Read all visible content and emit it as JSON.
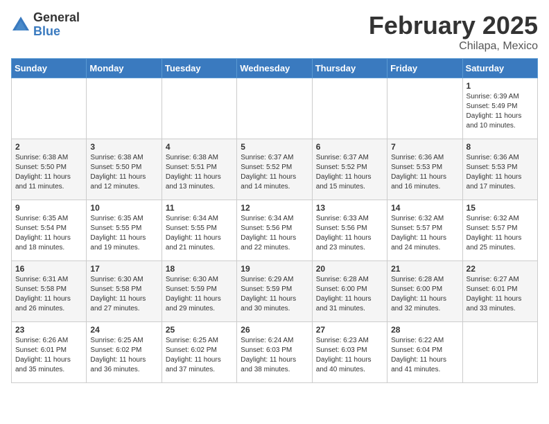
{
  "header": {
    "logo_general": "General",
    "logo_blue": "Blue",
    "title": "February 2025",
    "subtitle": "Chilapa, Mexico"
  },
  "days_of_week": [
    "Sunday",
    "Monday",
    "Tuesday",
    "Wednesday",
    "Thursday",
    "Friday",
    "Saturday"
  ],
  "weeks": [
    [
      {
        "day": "",
        "info": ""
      },
      {
        "day": "",
        "info": ""
      },
      {
        "day": "",
        "info": ""
      },
      {
        "day": "",
        "info": ""
      },
      {
        "day": "",
        "info": ""
      },
      {
        "day": "",
        "info": ""
      },
      {
        "day": "1",
        "info": "Sunrise: 6:39 AM\nSunset: 5:49 PM\nDaylight: 11 hours\nand 10 minutes."
      }
    ],
    [
      {
        "day": "2",
        "info": "Sunrise: 6:38 AM\nSunset: 5:50 PM\nDaylight: 11 hours\nand 11 minutes."
      },
      {
        "day": "3",
        "info": "Sunrise: 6:38 AM\nSunset: 5:50 PM\nDaylight: 11 hours\nand 12 minutes."
      },
      {
        "day": "4",
        "info": "Sunrise: 6:38 AM\nSunset: 5:51 PM\nDaylight: 11 hours\nand 13 minutes."
      },
      {
        "day": "5",
        "info": "Sunrise: 6:37 AM\nSunset: 5:52 PM\nDaylight: 11 hours\nand 14 minutes."
      },
      {
        "day": "6",
        "info": "Sunrise: 6:37 AM\nSunset: 5:52 PM\nDaylight: 11 hours\nand 15 minutes."
      },
      {
        "day": "7",
        "info": "Sunrise: 6:36 AM\nSunset: 5:53 PM\nDaylight: 11 hours\nand 16 minutes."
      },
      {
        "day": "8",
        "info": "Sunrise: 6:36 AM\nSunset: 5:53 PM\nDaylight: 11 hours\nand 17 minutes."
      }
    ],
    [
      {
        "day": "9",
        "info": "Sunrise: 6:35 AM\nSunset: 5:54 PM\nDaylight: 11 hours\nand 18 minutes."
      },
      {
        "day": "10",
        "info": "Sunrise: 6:35 AM\nSunset: 5:55 PM\nDaylight: 11 hours\nand 19 minutes."
      },
      {
        "day": "11",
        "info": "Sunrise: 6:34 AM\nSunset: 5:55 PM\nDaylight: 11 hours\nand 21 minutes."
      },
      {
        "day": "12",
        "info": "Sunrise: 6:34 AM\nSunset: 5:56 PM\nDaylight: 11 hours\nand 22 minutes."
      },
      {
        "day": "13",
        "info": "Sunrise: 6:33 AM\nSunset: 5:56 PM\nDaylight: 11 hours\nand 23 minutes."
      },
      {
        "day": "14",
        "info": "Sunrise: 6:32 AM\nSunset: 5:57 PM\nDaylight: 11 hours\nand 24 minutes."
      },
      {
        "day": "15",
        "info": "Sunrise: 6:32 AM\nSunset: 5:57 PM\nDaylight: 11 hours\nand 25 minutes."
      }
    ],
    [
      {
        "day": "16",
        "info": "Sunrise: 6:31 AM\nSunset: 5:58 PM\nDaylight: 11 hours\nand 26 minutes."
      },
      {
        "day": "17",
        "info": "Sunrise: 6:30 AM\nSunset: 5:58 PM\nDaylight: 11 hours\nand 27 minutes."
      },
      {
        "day": "18",
        "info": "Sunrise: 6:30 AM\nSunset: 5:59 PM\nDaylight: 11 hours\nand 29 minutes."
      },
      {
        "day": "19",
        "info": "Sunrise: 6:29 AM\nSunset: 5:59 PM\nDaylight: 11 hours\nand 30 minutes."
      },
      {
        "day": "20",
        "info": "Sunrise: 6:28 AM\nSunset: 6:00 PM\nDaylight: 11 hours\nand 31 minutes."
      },
      {
        "day": "21",
        "info": "Sunrise: 6:28 AM\nSunset: 6:00 PM\nDaylight: 11 hours\nand 32 minutes."
      },
      {
        "day": "22",
        "info": "Sunrise: 6:27 AM\nSunset: 6:01 PM\nDaylight: 11 hours\nand 33 minutes."
      }
    ],
    [
      {
        "day": "23",
        "info": "Sunrise: 6:26 AM\nSunset: 6:01 PM\nDaylight: 11 hours\nand 35 minutes."
      },
      {
        "day": "24",
        "info": "Sunrise: 6:25 AM\nSunset: 6:02 PM\nDaylight: 11 hours\nand 36 minutes."
      },
      {
        "day": "25",
        "info": "Sunrise: 6:25 AM\nSunset: 6:02 PM\nDaylight: 11 hours\nand 37 minutes."
      },
      {
        "day": "26",
        "info": "Sunrise: 6:24 AM\nSunset: 6:03 PM\nDaylight: 11 hours\nand 38 minutes."
      },
      {
        "day": "27",
        "info": "Sunrise: 6:23 AM\nSunset: 6:03 PM\nDaylight: 11 hours\nand 40 minutes."
      },
      {
        "day": "28",
        "info": "Sunrise: 6:22 AM\nSunset: 6:04 PM\nDaylight: 11 hours\nand 41 minutes."
      },
      {
        "day": "",
        "info": ""
      }
    ]
  ]
}
